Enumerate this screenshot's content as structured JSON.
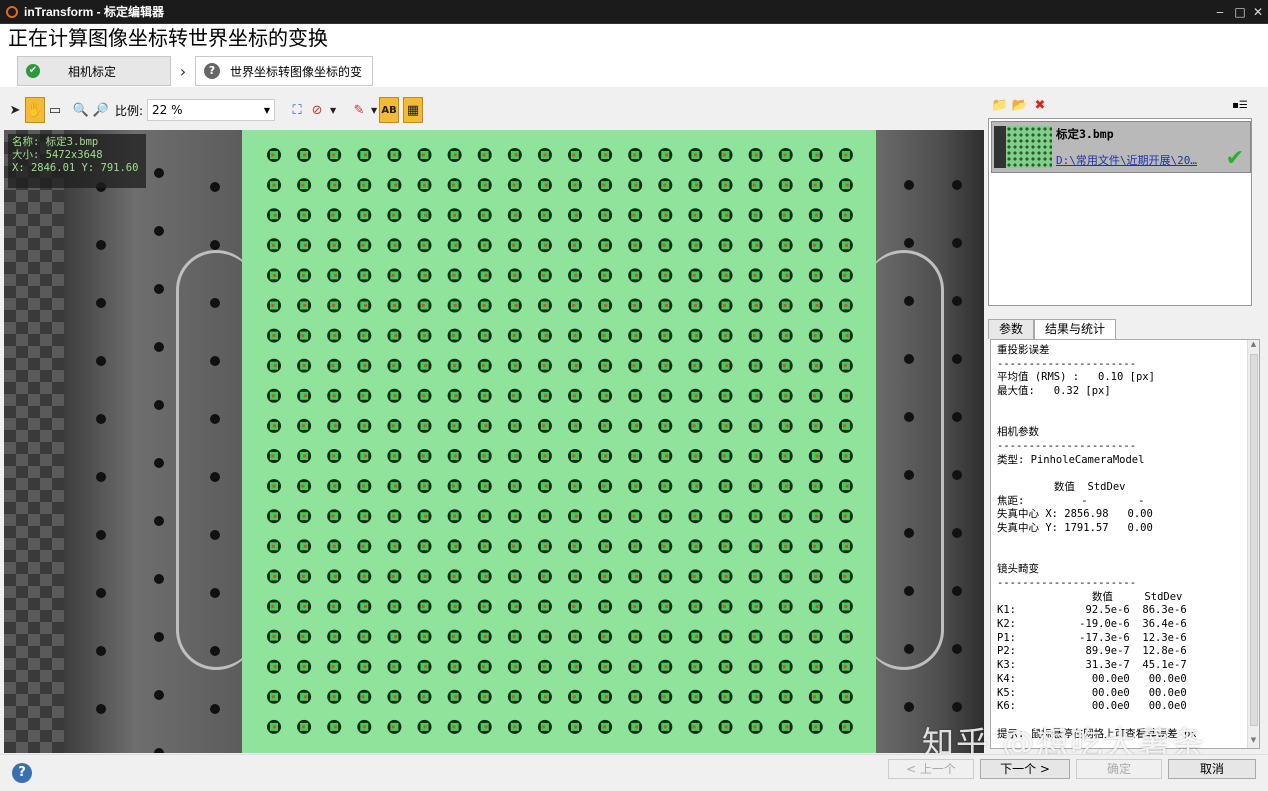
{
  "window": {
    "app_name": "inTransform",
    "title": "inTransform - 标定编辑器"
  },
  "page": {
    "heading": "正在计算图像坐标转世界坐标的变换"
  },
  "steps": [
    {
      "label": "相机标定",
      "status": "done"
    },
    {
      "label": "世界坐标转图像坐标的变",
      "status": "pending"
    }
  ],
  "toolbar": {
    "scale_label": "比例:",
    "scale_value": "22 %"
  },
  "viewer": {
    "info": {
      "name": "名称: 标定3.bmp",
      "size": "大小: 5472x3648",
      "coords": "X: 2846.01 Y: 791.60"
    }
  },
  "file_list": {
    "items": [
      {
        "name": "标定3.bmp",
        "path": "D:\\常用文件\\近期开展\\20…"
      }
    ]
  },
  "tabs": [
    {
      "label": "参数"
    },
    {
      "label": "结果与统计"
    }
  ],
  "results": {
    "lines": [
      "重投影误差",
      "----------------------",
      "平均值 (RMS) :   0.10 [px]",
      "最大值:   0.32 [px]",
      "",
      "",
      "相机参数",
      "----------------------",
      "类型: PinholeCameraModel",
      "",
      "         数值  StdDev",
      "焦距:         -        -",
      "失真中心 X: 2856.98   0.00",
      "失真中心 Y: 1791.57   0.00",
      "",
      "",
      "镜头畸变",
      "----------------------",
      "               数值     StdDev",
      "K1:           92.5e-6  86.3e-6",
      "K2:          -19.0e-6  36.4e-6",
      "P1:          -17.3e-6  12.3e-6",
      "P2:           89.9e-7  12.8e-6",
      "K3:           31.3e-7  45.1e-7",
      "K4:            00.0e0   00.0e0",
      "K5:            00.0e0   00.0e0",
      "K6:            00.0e0   00.0e0",
      "",
      "提示: 鼠标悬停在网格上可查看其误差 px"
    ]
  },
  "buttons": {
    "prev": "< 上一个",
    "next": "下一个 >",
    "ok": "确定",
    "cancel": "取消"
  },
  "watermark": "知乎 @想吃大薯条",
  "colors": {
    "board_green": "#8fe39a",
    "highlight": "#f3b93a",
    "marker_red": "#d9502a"
  }
}
